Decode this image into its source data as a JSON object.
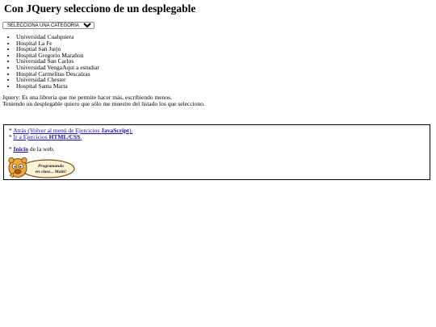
{
  "page_title": "Con JQuery selecciono de un desplegable",
  "select": {
    "selected_label": "SELECCIONA UNA CATEGORIA"
  },
  "hospitals": [
    "Universidad Cualquiera",
    "Hospital La Fe",
    "Hosptial San Jurjo",
    "Hospital Gregorio Marañon",
    "Universidad San Carlos",
    "Universidad VengaAqui a estudiar",
    "Hospital Carmelitas Descalzas",
    "Universidad Chester",
    "Hospital Santa Marta"
  ],
  "description": {
    "line1": "Jquery: Es una libreria que me permite hacer más, escribiendo menos.",
    "line2": "Teniendo un desplegable quiero que sólo me muestre del listado los que selecciono."
  },
  "nav": {
    "star": "*",
    "back_prefix": "Atrás (Volver al menú de Ejercicios ",
    "back_bold": "JavaScript",
    "back_suffix": ").",
    "html_prefix": "Ir a Ejercicios ",
    "html_bold": "HTML/CSS",
    "html_suffix": ".",
    "home_bold": "Inicio",
    "home_suffix": " de la web."
  },
  "logo": {
    "line1": "Programando",
    "line2": "en clase... Maiti!"
  }
}
